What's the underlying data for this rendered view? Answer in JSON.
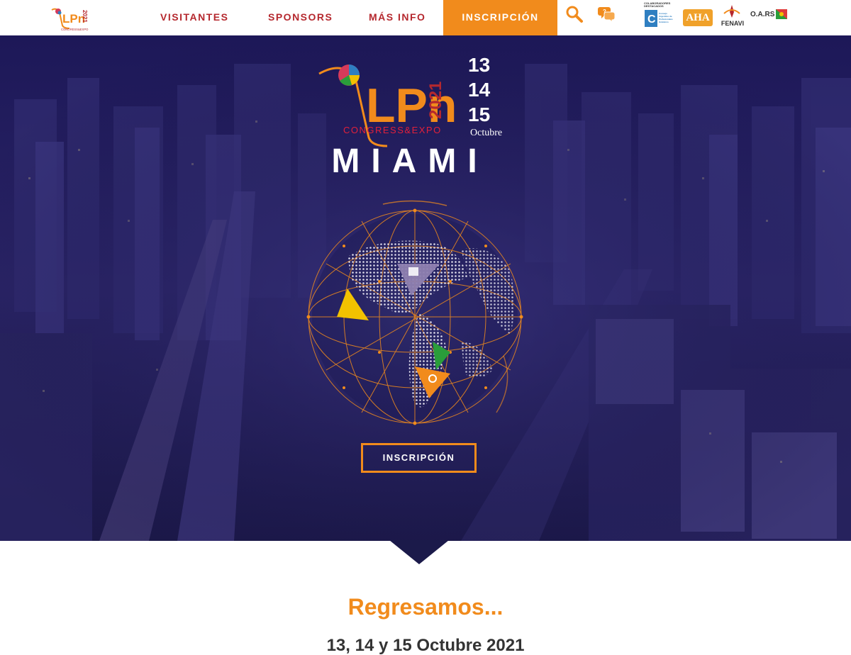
{
  "brand": {
    "nav_logo_letters": "LPn",
    "year": "2021",
    "tagline": "CONGRESS&EXPO",
    "colors": {
      "orange": "#f18b1c",
      "red": "#b5282e",
      "navy": "#1a1550"
    }
  },
  "nav": {
    "links": [
      "VISITANTES",
      "SPONSORS",
      "MÁS INFO"
    ],
    "cta_label": "INSCRIPCIÓN",
    "icons": [
      "search-icon",
      "chat-bubbles-icon"
    ]
  },
  "partners": {
    "caption": "COLABORADORES DESTACADOS",
    "items": [
      {
        "name": "colegio-logo",
        "text": "Consejo Argentino de Profesionales Hoteleros"
      },
      {
        "name": "aha-logo",
        "text": "AHA"
      },
      {
        "name": "fenavi-logo",
        "text": "FENAVI"
      },
      {
        "name": "oars-logo",
        "text": "O.A.RS"
      }
    ]
  },
  "hero": {
    "dates": [
      "13",
      "14",
      "15"
    ],
    "month": "Octubre",
    "city": "MIAMI",
    "cta_label": "INSCRIPCIÓN"
  },
  "content": {
    "headline": "Regresamos...",
    "subline": "13, 14 y 15 Octubre 2021"
  }
}
